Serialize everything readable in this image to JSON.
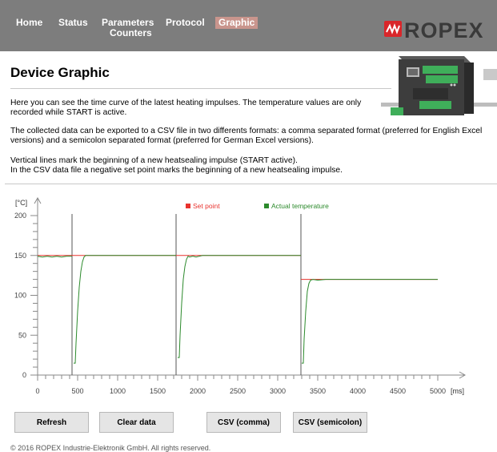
{
  "nav": {
    "items": [
      {
        "label": "Home"
      },
      {
        "label": "Status"
      },
      {
        "label_line1": "Parameters",
        "label_line2": "Counters"
      },
      {
        "label": "Protocol"
      },
      {
        "label": "Graphic"
      }
    ],
    "active_item": "Graphic",
    "active_bg": "#c9958d",
    "bar_color": "#7d7d7d"
  },
  "brand": {
    "name": "ROPEX",
    "accent": "#d9262a",
    "device_image": "ropex-controller-photo"
  },
  "page": {
    "title": "Device Graphic",
    "paragraph1": "Here you can see the time curve of the latest heating impulses. The temperature values are only recorded while START is active.",
    "paragraph2": "The collected data can be exported to a CSV file in two differents formats: a comma separated format (preferred for English Excel versions) and a semicolon separated format (preferred for German Excel versions).",
    "paragraph3a": "Vertical lines mark the beginning of a new heatsealing impulse (START active).",
    "paragraph3b": "In the CSV data file a negative set point marks the beginning of a new heatsealing impulse."
  },
  "chart_data": {
    "type": "line",
    "ylabel": "[°C]",
    "xlabel": "[ms]",
    "xlim": [
      0,
      5000
    ],
    "ylim": [
      0,
      200
    ],
    "x_ticks": [
      0,
      500,
      1000,
      1500,
      2000,
      2500,
      3000,
      3500,
      4000,
      4500,
      5000
    ],
    "y_ticks": [
      0,
      50,
      100,
      150,
      200
    ],
    "impulse_starts": [
      430,
      1730,
      3290
    ],
    "legend": [
      {
        "name": "Set point",
        "color": "#e8322d"
      },
      {
        "name": "Actual temperature",
        "color": "#2c8a2c"
      }
    ],
    "series": [
      {
        "name": "Set point",
        "color": "#e8322d",
        "segments": [
          [
            [
              0,
              150
            ],
            [
              430,
              150
            ]
          ],
          [
            [
              430,
              150
            ],
            [
              1730,
              150
            ]
          ],
          [
            [
              1730,
              150
            ],
            [
              3290,
              150
            ]
          ],
          [
            [
              3290,
              120
            ],
            [
              5000,
              120
            ]
          ]
        ]
      },
      {
        "name": "Actual temperature",
        "color": "#2c8a2c",
        "segments": [
          [
            [
              0,
              149
            ],
            [
              60,
              148
            ],
            [
              120,
              149
            ],
            [
              180,
              148
            ],
            [
              240,
              149
            ],
            [
              300,
              148
            ],
            [
              360,
              149
            ],
            [
              430,
              149
            ]
          ],
          [
            [
              450,
              15
            ],
            [
              470,
              15
            ],
            [
              480,
              40
            ],
            [
              500,
              80
            ],
            [
              520,
              110
            ],
            [
              540,
              130
            ],
            [
              560,
              142
            ],
            [
              580,
              148
            ],
            [
              600,
              150
            ],
            [
              650,
              150
            ],
            [
              700,
              150
            ],
            [
              1000,
              150
            ],
            [
              1730,
              150
            ]
          ],
          [
            [
              1750,
              22
            ],
            [
              1770,
              22
            ],
            [
              1780,
              50
            ],
            [
              1800,
              90
            ],
            [
              1820,
              120
            ],
            [
              1840,
              136
            ],
            [
              1860,
              145
            ],
            [
              1880,
              149
            ],
            [
              1900,
              148
            ],
            [
              1940,
              149
            ],
            [
              1980,
              148
            ],
            [
              2020,
              149
            ],
            [
              2060,
              150
            ],
            [
              2200,
              150
            ],
            [
              3290,
              150
            ]
          ],
          [
            [
              3300,
              15
            ],
            [
              3320,
              15
            ],
            [
              3330,
              45
            ],
            [
              3350,
              80
            ],
            [
              3370,
              105
            ],
            [
              3390,
              115
            ],
            [
              3410,
              119
            ],
            [
              3440,
              120
            ],
            [
              3500,
              119
            ],
            [
              3600,
              120
            ],
            [
              3800,
              120
            ],
            [
              4200,
              120
            ],
            [
              5000,
              120
            ]
          ]
        ]
      }
    ],
    "grid": false,
    "legend_position": "top-center"
  },
  "buttons": {
    "refresh": "Refresh",
    "clear": "Clear data",
    "csv_comma": "CSV (comma)",
    "csv_semicolon": "CSV (semicolon)"
  },
  "footer": {
    "text": "© 2016 ROPEX Industrie-Elektronik GmbH. All rights reserved."
  }
}
